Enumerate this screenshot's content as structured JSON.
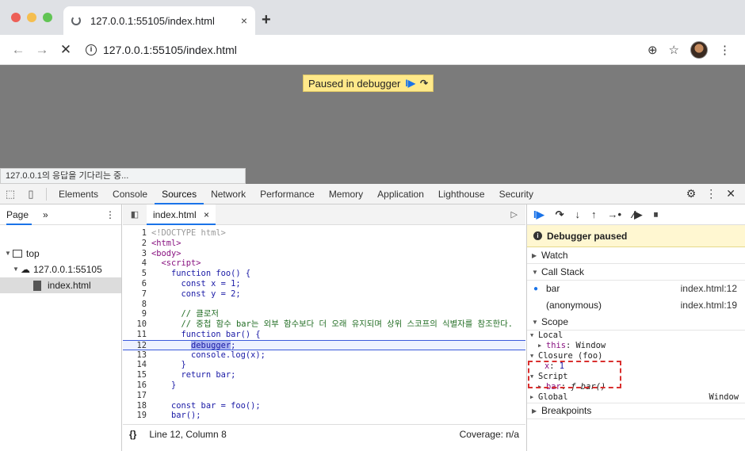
{
  "browser": {
    "tab_title": "127.0.0.1:55105/index.html",
    "tab_close": "×",
    "new_tab": "+",
    "url": "127.0.0.1:55105/index.html",
    "info_glyph": "i",
    "back_glyph": "←",
    "forward_glyph": "→",
    "stop_glyph": "✕",
    "zoom_glyph": "⊕",
    "star_glyph": "☆",
    "menu_glyph": "⋮"
  },
  "viewport": {
    "paused_label": "Paused in debugger",
    "resume_glyph": "I▶",
    "step_glyph": "↷",
    "status_text": "127.0.0.1의 응답을 기다리는 중..."
  },
  "devtools": {
    "tabs": [
      "Elements",
      "Console",
      "Sources",
      "Network",
      "Performance",
      "Memory",
      "Application",
      "Lighthouse",
      "Security"
    ],
    "active_tab": "Sources",
    "inspect_glyph": "⬚",
    "device_glyph": "▯",
    "settings_glyph": "⚙",
    "more_glyph": "⋮",
    "close_glyph": "✕"
  },
  "navigator": {
    "tab_label": "Page",
    "more": "»",
    "kebab": "⋮",
    "tree": {
      "top": "top",
      "origin": "127.0.0.1:55105",
      "file": "index.html"
    }
  },
  "editor": {
    "file_tab": "index.html",
    "file_close": "×",
    "toggle_glyph": "◧",
    "right_glyph": "▷",
    "lines": [
      {
        "n": "1",
        "text": "<!DOCTYPE html>",
        "kind": "doctype"
      },
      {
        "n": "2",
        "text": "<html>",
        "kind": "tag"
      },
      {
        "n": "3",
        "text": "<body>",
        "kind": "tag"
      },
      {
        "n": "4",
        "text": "  <script>",
        "kind": "tag"
      },
      {
        "n": "5",
        "text": "    function foo() {",
        "kind": "code"
      },
      {
        "n": "6",
        "text": "      const x = 1;",
        "kind": "code"
      },
      {
        "n": "7",
        "text": "      const y = 2;",
        "kind": "code"
      },
      {
        "n": "8",
        "text": "",
        "kind": "code"
      },
      {
        "n": "9",
        "text": "      // 클로저",
        "kind": "comment"
      },
      {
        "n": "10",
        "text": "      // 중첩 함수 bar는 외부 함수보다 더 오래 유지되며 상위 스코프의 식별자를 참조한다.",
        "kind": "comment"
      },
      {
        "n": "11",
        "text": "      function bar() {",
        "kind": "code"
      },
      {
        "n": "12",
        "text": "debugger",
        "kind": "paused",
        "prefix": "        ",
        "suffix": ";"
      },
      {
        "n": "13",
        "text": "        console.log(x);",
        "kind": "code"
      },
      {
        "n": "14",
        "text": "      }",
        "kind": "code"
      },
      {
        "n": "15",
        "text": "      return bar;",
        "kind": "code"
      },
      {
        "n": "16",
        "text": "    }",
        "kind": "code"
      },
      {
        "n": "17",
        "text": "",
        "kind": "code"
      },
      {
        "n": "18",
        "text": "    const bar = foo();",
        "kind": "code"
      },
      {
        "n": "19",
        "text": "    bar();",
        "kind": "code"
      }
    ],
    "status_braces": "{}",
    "status_position": "Line 12, Column 8",
    "status_coverage": "Coverage: n/a"
  },
  "debugger": {
    "paused_message": "Debugger paused",
    "watch": "Watch",
    "call_stack": "Call Stack",
    "frames": [
      {
        "fn": "bar",
        "loc": "index.html:12",
        "current": true
      },
      {
        "fn": "(anonymous)",
        "loc": "index.html:19",
        "current": false
      }
    ],
    "scope": "Scope",
    "local": "Local",
    "this_key": "this",
    "this_val": "Window",
    "closure": "Closure (foo)",
    "closure_x_key": "x",
    "closure_x_val": "1",
    "script": "Script",
    "script_bar_key": "bar",
    "script_bar_val": "ƒ bar()",
    "global": "Global",
    "global_val": "Window",
    "breakpoints": "Breakpoints"
  },
  "colors": {
    "accent": "#1a73e8",
    "highlight_box": "#d9302f",
    "paused_banner": "#ffe98a"
  }
}
